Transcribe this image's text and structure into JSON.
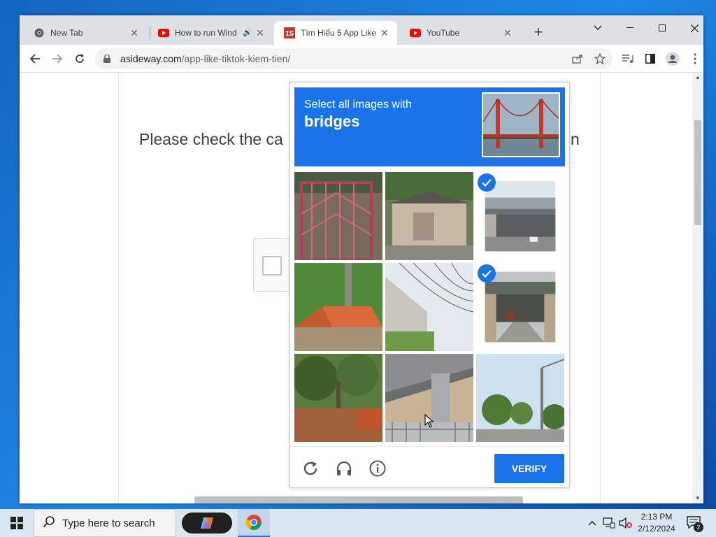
{
  "browser": {
    "tabs": [
      {
        "title": "New Tab",
        "icon": "chrome-icon",
        "active": false
      },
      {
        "title": "How to run Wind",
        "icon": "youtube-icon",
        "active": false,
        "audio": true
      },
      {
        "title": "Tìm Hiểu 5 App Like",
        "icon": "site-1s-icon",
        "active": true
      },
      {
        "title": "YouTube",
        "icon": "youtube-icon",
        "active": false
      }
    ],
    "url": {
      "host": "asideway.com",
      "path": "/app-like-tiktok-kiem-tien/"
    }
  },
  "page": {
    "message_start": "Please check the ca",
    "message_end": "n"
  },
  "captcha": {
    "instruction": "Select all images with",
    "target": "bridges",
    "verify_label": "VERIFY",
    "tiles": [
      {
        "subject": "gate",
        "selected": false
      },
      {
        "subject": "house",
        "selected": false
      },
      {
        "subject": "bridge",
        "selected": true
      },
      {
        "subject": "roof",
        "selected": false
      },
      {
        "subject": "wires",
        "selected": false
      },
      {
        "subject": "bridge",
        "selected": true
      },
      {
        "subject": "trees",
        "selected": false
      },
      {
        "subject": "overpass",
        "selected": false
      },
      {
        "subject": "road",
        "selected": false
      }
    ],
    "accent_color": "#1a73e8"
  },
  "taskbar": {
    "search_placeholder": "Type here to search",
    "time": "2:13 PM",
    "date": "2/12/2024",
    "notification_count": "2"
  }
}
